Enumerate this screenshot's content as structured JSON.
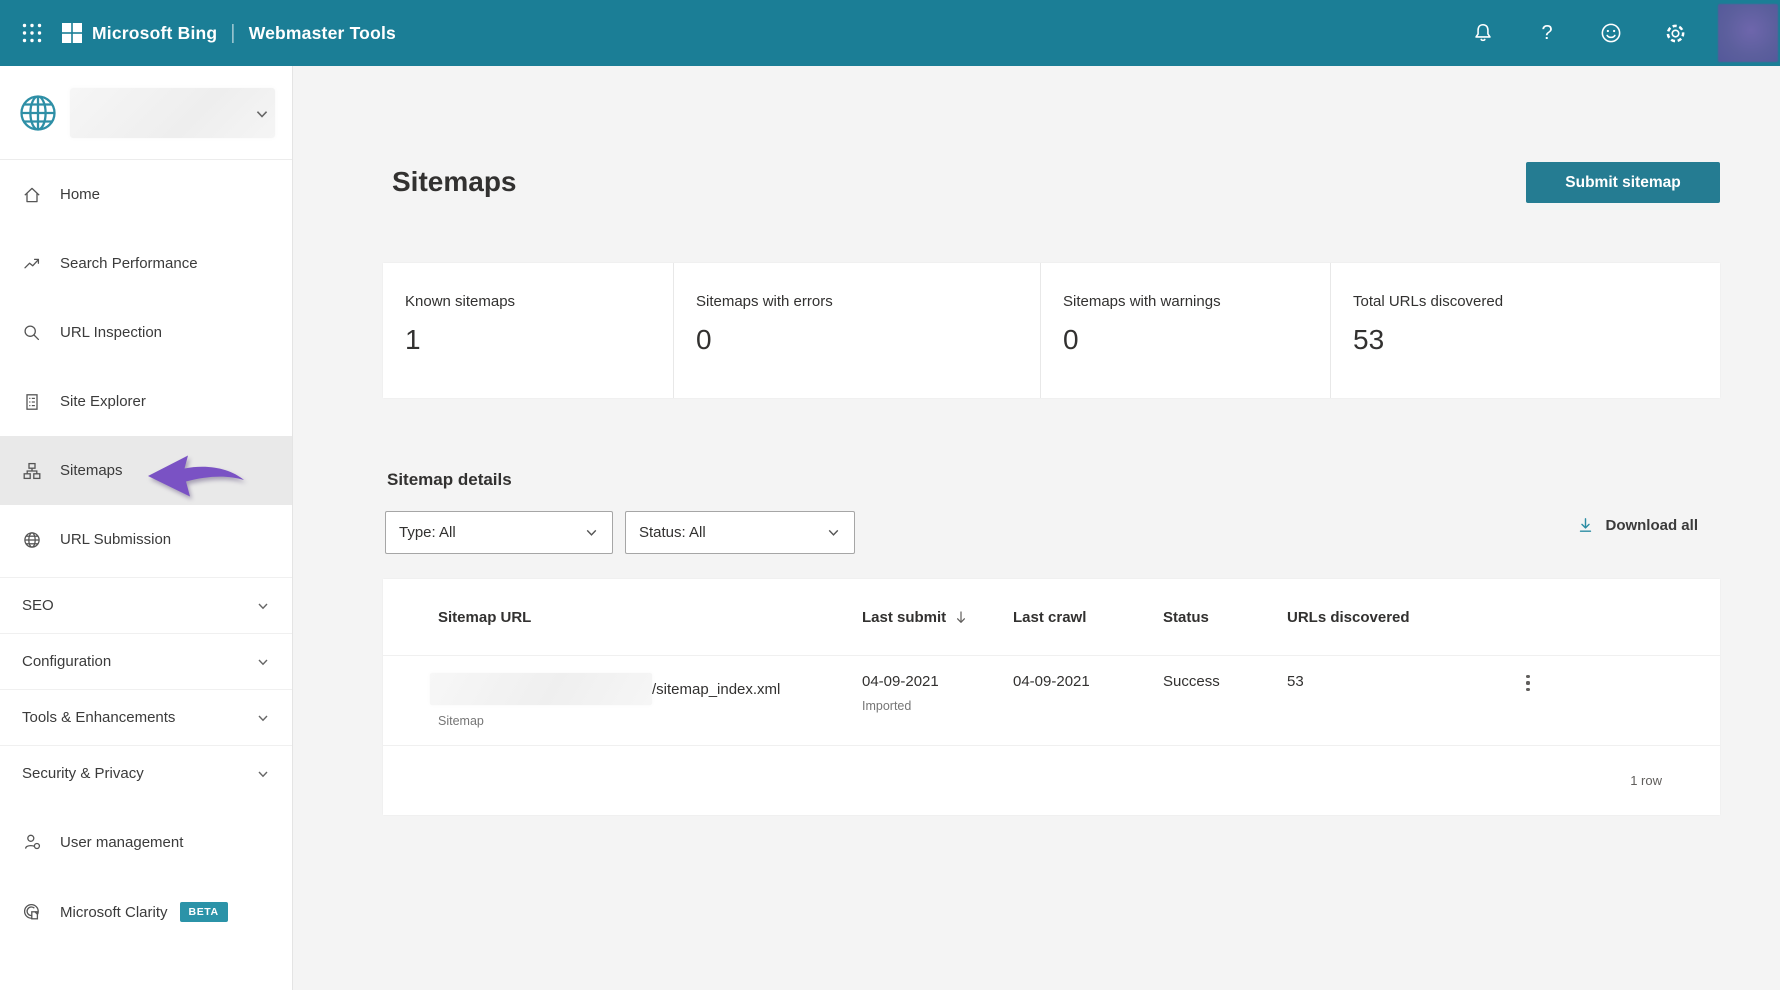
{
  "header": {
    "brand": "Microsoft Bing",
    "product": "Webmaster Tools",
    "separator": "|",
    "help_glyph": "?"
  },
  "sidebar": {
    "items": [
      {
        "label": "Home"
      },
      {
        "label": "Search Performance"
      },
      {
        "label": "URL Inspection"
      },
      {
        "label": "Site Explorer"
      },
      {
        "label": "Sitemaps",
        "active": true
      },
      {
        "label": "URL Submission"
      }
    ],
    "sections": [
      "SEO",
      "Configuration",
      "Tools & Enhancements",
      "Security & Privacy"
    ],
    "user_management": "User management",
    "clarity": "Microsoft Clarity",
    "clarity_badge": "BETA"
  },
  "page": {
    "title": "Sitemaps",
    "submit_button": "Submit sitemap"
  },
  "stats": [
    {
      "label": "Known sitemaps",
      "value": "1"
    },
    {
      "label": "Sitemaps with errors",
      "value": "0"
    },
    {
      "label": "Sitemaps with warnings",
      "value": "0"
    },
    {
      "label": "Total URLs discovered",
      "value": "53"
    }
  ],
  "details": {
    "heading": "Sitemap details",
    "type_filter": "Type: All",
    "status_filter": "Status: All",
    "download_all": "Download all"
  },
  "table": {
    "headers": {
      "url": "Sitemap URL",
      "last_submit": "Last submit",
      "last_crawl": "Last crawl",
      "status": "Status",
      "urls": "URLs discovered"
    },
    "sort_column": "Last submit",
    "row": {
      "url_suffix": "/sitemap_index.xml",
      "url_redacted": true,
      "type": "Sitemap",
      "last_submit": "04-09-2021",
      "last_submit_note": "Imported",
      "last_crawl": "04-09-2021",
      "status": "Success",
      "urls": "53"
    },
    "footer": "1 row"
  },
  "colors": {
    "header_teal": "#1B7E96",
    "button_teal": "#257C92",
    "accent_teal": "#2B8CA3",
    "beta_teal": "#2B93A8",
    "arrow_purple": "#7A52C4"
  }
}
